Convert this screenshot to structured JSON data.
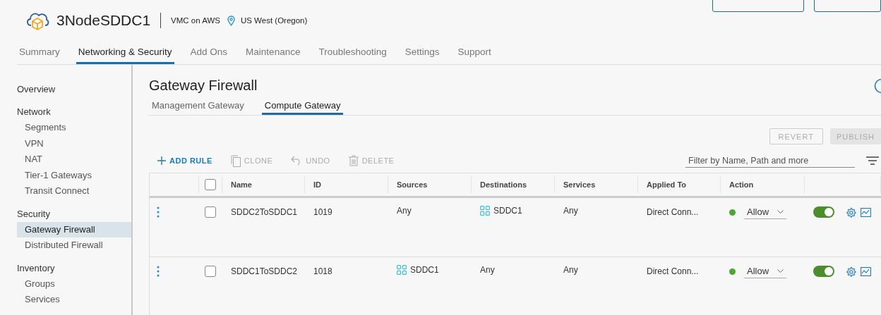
{
  "header": {
    "title": "3NodeSDDC1",
    "platform": "VMC on AWS",
    "region": "US West (Oregon)"
  },
  "tabs": [
    {
      "label": "Summary",
      "selected": false
    },
    {
      "label": "Networking & Security",
      "selected": true
    },
    {
      "label": "Add Ons",
      "selected": false
    },
    {
      "label": "Maintenance",
      "selected": false
    },
    {
      "label": "Troubleshooting",
      "selected": false
    },
    {
      "label": "Settings",
      "selected": false
    },
    {
      "label": "Support",
      "selected": false
    }
  ],
  "sidebar": {
    "sections": [
      {
        "title": "Overview"
      },
      {
        "title": "Network",
        "items": [
          {
            "label": "Segments",
            "selected": false
          },
          {
            "label": "VPN",
            "selected": false
          },
          {
            "label": "NAT",
            "selected": false
          },
          {
            "label": "Tier-1 Gateways",
            "selected": false
          },
          {
            "label": "Transit Connect",
            "selected": false
          }
        ]
      },
      {
        "title": "Security",
        "items": [
          {
            "label": "Gateway Firewall",
            "selected": true
          },
          {
            "label": "Distributed Firewall",
            "selected": false
          }
        ]
      },
      {
        "title": "Inventory",
        "items": [
          {
            "label": "Groups",
            "selected": false
          },
          {
            "label": "Services",
            "selected": false
          }
        ]
      }
    ]
  },
  "page": {
    "title": "Gateway Firewall",
    "subtabs": [
      {
        "label": "Management Gateway",
        "selected": false
      },
      {
        "label": "Compute Gateway",
        "selected": true
      }
    ],
    "revert": "REVERT",
    "publish": "PUBLISH",
    "toolbar": [
      {
        "kind": "add",
        "label": "ADD RULE",
        "disabled": false
      },
      {
        "kind": "clone",
        "label": "CLONE",
        "disabled": true
      },
      {
        "kind": "undo",
        "label": "UNDO",
        "disabled": true
      },
      {
        "kind": "delete",
        "label": "DELETE",
        "disabled": true
      }
    ],
    "filter": {
      "placeholder": "Filter by Name, Path and more"
    }
  },
  "table": {
    "select_all_checked": false,
    "columns": [
      "Name",
      "ID",
      "Sources",
      "Destinations",
      "Services",
      "Applied To",
      "Action"
    ],
    "rows": [
      {
        "checked": false,
        "name": "SDDC2ToSDDC1",
        "id": "1019",
        "sources": {
          "kind": "any",
          "text": "Any"
        },
        "destinations": {
          "kind": "group",
          "text": "SDDC1"
        },
        "services": "Any",
        "applied_to": "Direct Conn...",
        "action": "Allow",
        "color": "#48a830",
        "enabled": true
      },
      {
        "checked": false,
        "name": "SDDC1ToSDDC2",
        "id": "1018",
        "sources": {
          "kind": "group",
          "text": "SDDC1"
        },
        "destinations": {
          "kind": "any",
          "text": "Any"
        },
        "services": "Any",
        "applied_to": "Direct Conn...",
        "action": "Allow",
        "color": "#48a830",
        "enabled": true
      }
    ]
  }
}
